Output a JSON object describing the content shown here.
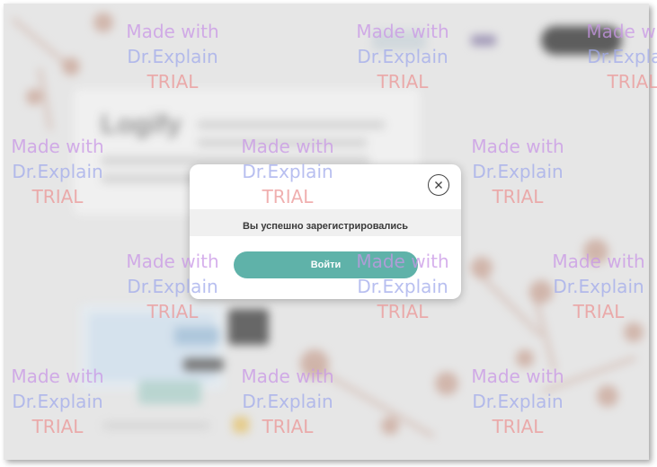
{
  "background": {
    "logo_text": "Logify"
  },
  "modal": {
    "message": "Вы успешно зарегистрировались",
    "login_button": "Войти",
    "close_icon": "close-icon",
    "accent_color": "#5fb2a9"
  },
  "watermark": {
    "line1": "Made with",
    "line2": "Dr.Explain",
    "line3": "TRIAL"
  }
}
